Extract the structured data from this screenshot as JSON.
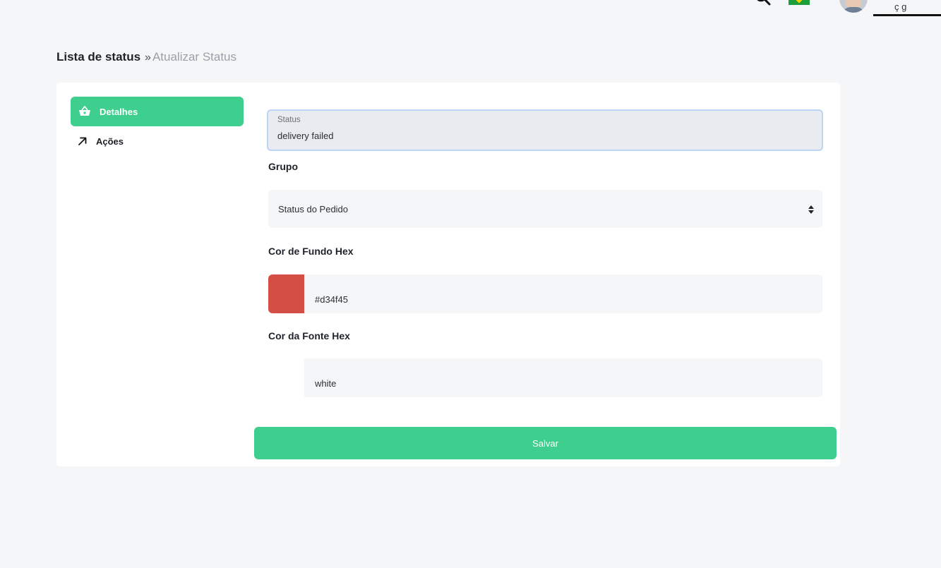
{
  "header": {
    "user_name": "ç g",
    "language_flag": "flag-brazil",
    "search_icon": "search-icon"
  },
  "breadcrumb": {
    "root": "Lista de status",
    "separator": "»",
    "current": "Atualizar Status"
  },
  "sidebar": {
    "items": [
      {
        "label": "Detalhes",
        "icon": "basket-icon",
        "active": true
      },
      {
        "label": "Ações",
        "icon": "arrow-up-right-icon",
        "active": false
      }
    ]
  },
  "form": {
    "status": {
      "label": "Status",
      "value": "delivery failed"
    },
    "group": {
      "label": "Grupo",
      "value": "Status do Pedido"
    },
    "background_color": {
      "label": "Cor de Fundo Hex",
      "value": "#d34f45",
      "swatch": "#d34f45"
    },
    "font_color": {
      "label": "Cor da Fonte Hex",
      "value": "white",
      "swatch": "#ffffff"
    },
    "save_label": "Salvar"
  },
  "colors": {
    "accent": "#3ecf8e",
    "page_background": "#f5f6f8",
    "focus_border": "#bcd5f7"
  }
}
